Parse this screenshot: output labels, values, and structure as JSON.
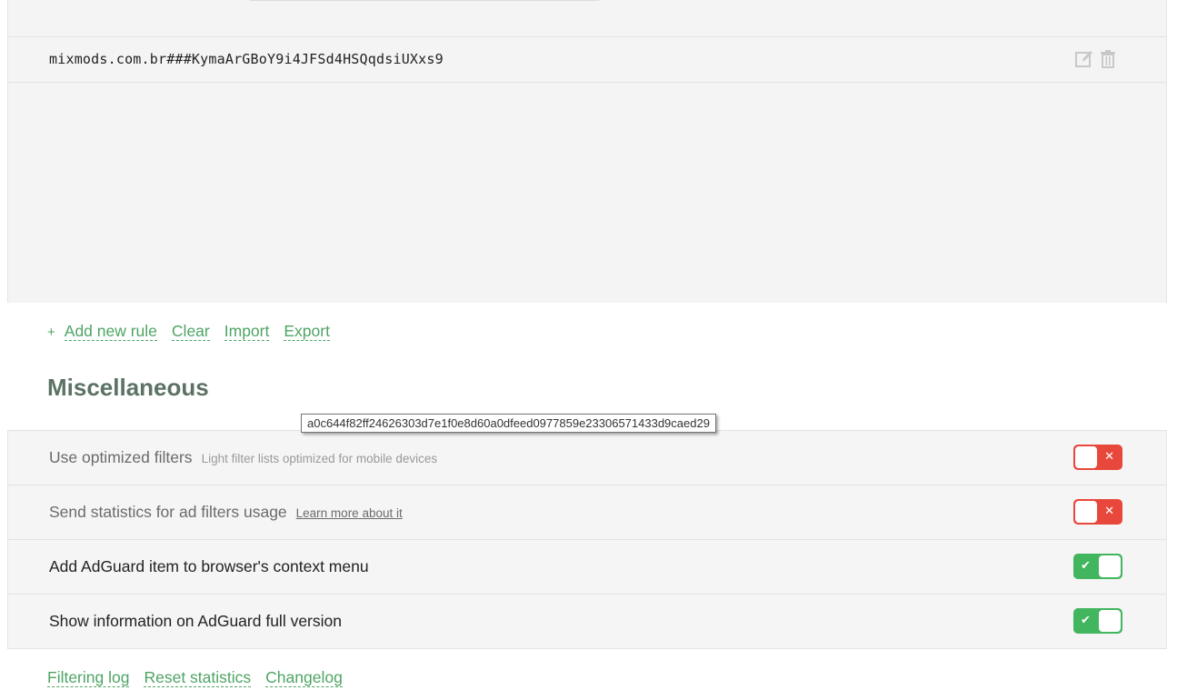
{
  "rules": {
    "items": [
      {
        "text": "mixmods.com.br###KymaArGBoY9i4JFSd4HSQqdsiUXxs9"
      }
    ],
    "icons": {
      "edit": "edit-icon",
      "delete": "trash-icon"
    },
    "actions": {
      "add_icon": "+",
      "add_label": "Add new rule",
      "clear_label": "Clear",
      "import_label": "Import",
      "export_label": "Export"
    }
  },
  "misc": {
    "title": "Miscellaneous",
    "settings": [
      {
        "label": "Use optimized filters",
        "sub": "Light filter lists optimized for mobile devices",
        "enabled": false
      },
      {
        "label": "Send statistics for ad filters usage",
        "sub": "Learn more about it",
        "enabled": false
      },
      {
        "label": "Add AdGuard item to browser's context menu",
        "enabled": true
      },
      {
        "label": "Show information on AdGuard full version",
        "enabled": true
      }
    ]
  },
  "tooltip": {
    "text": "a0c644f82ff24626303d7e1f0e8d60a0dfeed0977859e23306571433d9caed29"
  },
  "footer": {
    "filtering_log": "Filtering log",
    "reset_statistics": "Reset statistics",
    "changelog": "Changelog"
  },
  "colors": {
    "accent_green": "#4fa464",
    "toggle_on": "#42b55f",
    "toggle_off": "#e8483c",
    "title_color": "#5c7265"
  }
}
